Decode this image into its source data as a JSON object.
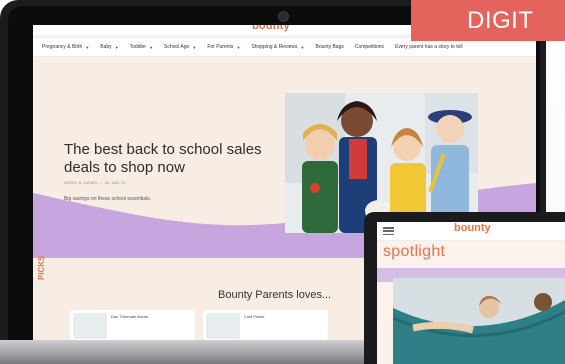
{
  "corner_badge": {
    "label": "DIGIT"
  },
  "site": {
    "logo": "bounty",
    "nav": [
      {
        "label": "Pregnancy & Birth",
        "chevron": true
      },
      {
        "label": "Baby",
        "chevron": true
      },
      {
        "label": "Toddler",
        "chevron": true
      },
      {
        "label": "School Age",
        "chevron": true
      },
      {
        "label": "For Parents",
        "chevron": true
      },
      {
        "label": "Shopping & Reviews",
        "chevron": true
      },
      {
        "label": "Bounty Bags",
        "chevron": false
      },
      {
        "label": "Competitions",
        "chevron": false
      },
      {
        "label": "Every parent has a story to tell",
        "chevron": false
      }
    ],
    "hero": {
      "headline": "The best back to school sales deals to shop now",
      "meta": "NEWS & VIEWS — 30 JAN 25",
      "subtitle": "Big savings on these school essentials."
    },
    "lower": {
      "picks": "PICKS",
      "section_title": "Bounty Parents loves...",
      "cards": [
        {
          "title": "Eau Thermale Avene"
        },
        {
          "title": "Cold Power"
        }
      ]
    }
  },
  "tablet": {
    "logo": "bounty",
    "section_title": "spotlight"
  },
  "colors": {
    "brand": "#e8734a",
    "lilac": "#c7a6df",
    "hero_bg": "#f8ede4",
    "badge": "#e4645d"
  },
  "icons": [
    "chevron-down-icon",
    "menu-icon",
    "camera-icon"
  ]
}
